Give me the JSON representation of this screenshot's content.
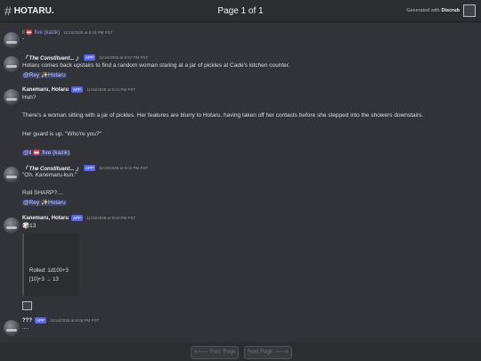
{
  "header": {
    "hash": "#",
    "channel": "HOTARU.",
    "page_indicator": "Page 1 of 1",
    "generated_prefix": "Generated with",
    "generated_brand": "Discrub"
  },
  "messages": [
    {
      "name": "ll 📛 five (kazik)",
      "app": "",
      "time": "11/16/2025 at 6:33 PM PST",
      "lines": [
        "-"
      ]
    },
    {
      "name": "「 The Constituent... 」",
      "app": "APP",
      "time": "11/16/2025 at 8:57 PM PST",
      "lines": [
        "Hotaru comes back upstairs to find a random woman staring at a jar of pickles at Cade's kitchen counter."
      ],
      "mention": "@Rey ✨Hotaru"
    },
    {
      "name": "Kanemaru, Hotaru",
      "app": "APP",
      "time": "11/16/2025 at 9:01 PM PST",
      "lines": [
        "Huh?",
        "There's a woman sitting with a jar of pickles. Her features are blurry to Hotaru, having taken off her contacts before she stepped into the showers downstairs.",
        "Her guard is up. \"Who're you?\""
      ],
      "mention": "@ll 📛 five (kazik)"
    },
    {
      "name": "「 The Constituent... 」",
      "app": "APP",
      "time": "11/16/2025 at 9:01 PM PST",
      "lines": [
        "\"Oh. Kanemaru-kun.\"",
        "Roll SHARP?...."
      ],
      "mention": "@Rey ✨Hotaru"
    },
    {
      "name": "Kanemaru, Hotaru",
      "app": "APP",
      "time": "11/16/2025 at 9:02 PM PST",
      "lines": [
        "🎲13"
      ],
      "embed": [
        "Rolled: 1d100+3",
        "[10]+3 → 13"
      ]
    },
    {
      "name": "???",
      "app": "APP",
      "time": "11/16/2025 at 9:09 PM PST",
      "lines": [
        "...."
      ]
    }
  ],
  "footer": {
    "prev": "🡐 Prev. Page",
    "next": "Next Page 🡒"
  },
  "colors": {
    "background": "#313338",
    "mention_bg": "#3c4270",
    "app_badge": "#5865f2"
  }
}
